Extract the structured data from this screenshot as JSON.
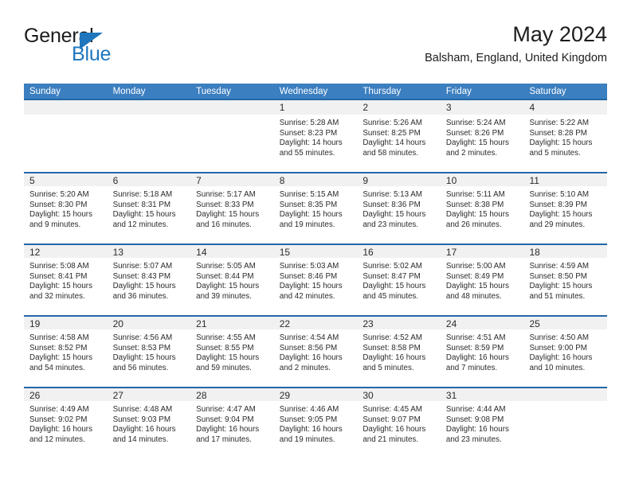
{
  "logo": {
    "primary_text": "General",
    "secondary_text": "Blue",
    "primary_color": "#1c1c1c",
    "accent_color": "#1f76bd"
  },
  "header": {
    "title": "May 2024",
    "subtitle": "Balsham, England, United Kingdom"
  },
  "theme": {
    "header_bg": "#3c7fc0",
    "header_text": "#ffffff",
    "row_separator": "#2268a8",
    "daynumber_bg": "#f1f1f1",
    "cell_bg": "#ffffff",
    "text": "#2b2b2b"
  },
  "weekdays": [
    "Sunday",
    "Monday",
    "Tuesday",
    "Wednesday",
    "Thursday",
    "Friday",
    "Saturday"
  ],
  "labels": {
    "sunrise": "Sunrise:",
    "sunset": "Sunset:",
    "daylight": "Daylight:"
  },
  "weeks": [
    [
      {
        "day": "",
        "sunrise": "",
        "sunset": "",
        "daylight": ""
      },
      {
        "day": "",
        "sunrise": "",
        "sunset": "",
        "daylight": ""
      },
      {
        "day": "",
        "sunrise": "",
        "sunset": "",
        "daylight": ""
      },
      {
        "day": "1",
        "sunrise": "Sunrise: 5:28 AM",
        "sunset": "Sunset: 8:23 PM",
        "daylight": "Daylight: 14 hours and 55 minutes."
      },
      {
        "day": "2",
        "sunrise": "Sunrise: 5:26 AM",
        "sunset": "Sunset: 8:25 PM",
        "daylight": "Daylight: 14 hours and 58 minutes."
      },
      {
        "day": "3",
        "sunrise": "Sunrise: 5:24 AM",
        "sunset": "Sunset: 8:26 PM",
        "daylight": "Daylight: 15 hours and 2 minutes."
      },
      {
        "day": "4",
        "sunrise": "Sunrise: 5:22 AM",
        "sunset": "Sunset: 8:28 PM",
        "daylight": "Daylight: 15 hours and 5 minutes."
      }
    ],
    [
      {
        "day": "5",
        "sunrise": "Sunrise: 5:20 AM",
        "sunset": "Sunset: 8:30 PM",
        "daylight": "Daylight: 15 hours and 9 minutes."
      },
      {
        "day": "6",
        "sunrise": "Sunrise: 5:18 AM",
        "sunset": "Sunset: 8:31 PM",
        "daylight": "Daylight: 15 hours and 12 minutes."
      },
      {
        "day": "7",
        "sunrise": "Sunrise: 5:17 AM",
        "sunset": "Sunset: 8:33 PM",
        "daylight": "Daylight: 15 hours and 16 minutes."
      },
      {
        "day": "8",
        "sunrise": "Sunrise: 5:15 AM",
        "sunset": "Sunset: 8:35 PM",
        "daylight": "Daylight: 15 hours and 19 minutes."
      },
      {
        "day": "9",
        "sunrise": "Sunrise: 5:13 AM",
        "sunset": "Sunset: 8:36 PM",
        "daylight": "Daylight: 15 hours and 23 minutes."
      },
      {
        "day": "10",
        "sunrise": "Sunrise: 5:11 AM",
        "sunset": "Sunset: 8:38 PM",
        "daylight": "Daylight: 15 hours and 26 minutes."
      },
      {
        "day": "11",
        "sunrise": "Sunrise: 5:10 AM",
        "sunset": "Sunset: 8:39 PM",
        "daylight": "Daylight: 15 hours and 29 minutes."
      }
    ],
    [
      {
        "day": "12",
        "sunrise": "Sunrise: 5:08 AM",
        "sunset": "Sunset: 8:41 PM",
        "daylight": "Daylight: 15 hours and 32 minutes."
      },
      {
        "day": "13",
        "sunrise": "Sunrise: 5:07 AM",
        "sunset": "Sunset: 8:43 PM",
        "daylight": "Daylight: 15 hours and 36 minutes."
      },
      {
        "day": "14",
        "sunrise": "Sunrise: 5:05 AM",
        "sunset": "Sunset: 8:44 PM",
        "daylight": "Daylight: 15 hours and 39 minutes."
      },
      {
        "day": "15",
        "sunrise": "Sunrise: 5:03 AM",
        "sunset": "Sunset: 8:46 PM",
        "daylight": "Daylight: 15 hours and 42 minutes."
      },
      {
        "day": "16",
        "sunrise": "Sunrise: 5:02 AM",
        "sunset": "Sunset: 8:47 PM",
        "daylight": "Daylight: 15 hours and 45 minutes."
      },
      {
        "day": "17",
        "sunrise": "Sunrise: 5:00 AM",
        "sunset": "Sunset: 8:49 PM",
        "daylight": "Daylight: 15 hours and 48 minutes."
      },
      {
        "day": "18",
        "sunrise": "Sunrise: 4:59 AM",
        "sunset": "Sunset: 8:50 PM",
        "daylight": "Daylight: 15 hours and 51 minutes."
      }
    ],
    [
      {
        "day": "19",
        "sunrise": "Sunrise: 4:58 AM",
        "sunset": "Sunset: 8:52 PM",
        "daylight": "Daylight: 15 hours and 54 minutes."
      },
      {
        "day": "20",
        "sunrise": "Sunrise: 4:56 AM",
        "sunset": "Sunset: 8:53 PM",
        "daylight": "Daylight: 15 hours and 56 minutes."
      },
      {
        "day": "21",
        "sunrise": "Sunrise: 4:55 AM",
        "sunset": "Sunset: 8:55 PM",
        "daylight": "Daylight: 15 hours and 59 minutes."
      },
      {
        "day": "22",
        "sunrise": "Sunrise: 4:54 AM",
        "sunset": "Sunset: 8:56 PM",
        "daylight": "Daylight: 16 hours and 2 minutes."
      },
      {
        "day": "23",
        "sunrise": "Sunrise: 4:52 AM",
        "sunset": "Sunset: 8:58 PM",
        "daylight": "Daylight: 16 hours and 5 minutes."
      },
      {
        "day": "24",
        "sunrise": "Sunrise: 4:51 AM",
        "sunset": "Sunset: 8:59 PM",
        "daylight": "Daylight: 16 hours and 7 minutes."
      },
      {
        "day": "25",
        "sunrise": "Sunrise: 4:50 AM",
        "sunset": "Sunset: 9:00 PM",
        "daylight": "Daylight: 16 hours and 10 minutes."
      }
    ],
    [
      {
        "day": "26",
        "sunrise": "Sunrise: 4:49 AM",
        "sunset": "Sunset: 9:02 PM",
        "daylight": "Daylight: 16 hours and 12 minutes."
      },
      {
        "day": "27",
        "sunrise": "Sunrise: 4:48 AM",
        "sunset": "Sunset: 9:03 PM",
        "daylight": "Daylight: 16 hours and 14 minutes."
      },
      {
        "day": "28",
        "sunrise": "Sunrise: 4:47 AM",
        "sunset": "Sunset: 9:04 PM",
        "daylight": "Daylight: 16 hours and 17 minutes."
      },
      {
        "day": "29",
        "sunrise": "Sunrise: 4:46 AM",
        "sunset": "Sunset: 9:05 PM",
        "daylight": "Daylight: 16 hours and 19 minutes."
      },
      {
        "day": "30",
        "sunrise": "Sunrise: 4:45 AM",
        "sunset": "Sunset: 9:07 PM",
        "daylight": "Daylight: 16 hours and 21 minutes."
      },
      {
        "day": "31",
        "sunrise": "Sunrise: 4:44 AM",
        "sunset": "Sunset: 9:08 PM",
        "daylight": "Daylight: 16 hours and 23 minutes."
      },
      {
        "day": "",
        "sunrise": "",
        "sunset": "",
        "daylight": ""
      }
    ]
  ]
}
